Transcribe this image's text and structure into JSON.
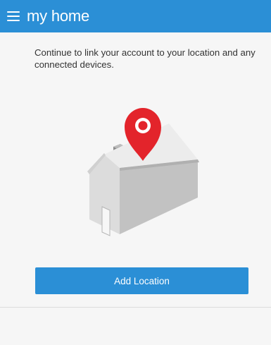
{
  "header": {
    "title": "my home",
    "menu_icon": "hamburger-menu-icon",
    "background_color": "#2b8fd6"
  },
  "main": {
    "intro_text": "Continue to link your account to your location and any connected devices.",
    "illustration": {
      "house_icon": "house-icon",
      "pin_icon": "location-pin-icon",
      "pin_color": "#e3242b"
    },
    "add_location_label": "Add Location",
    "button_color": "#2b8fd6"
  }
}
